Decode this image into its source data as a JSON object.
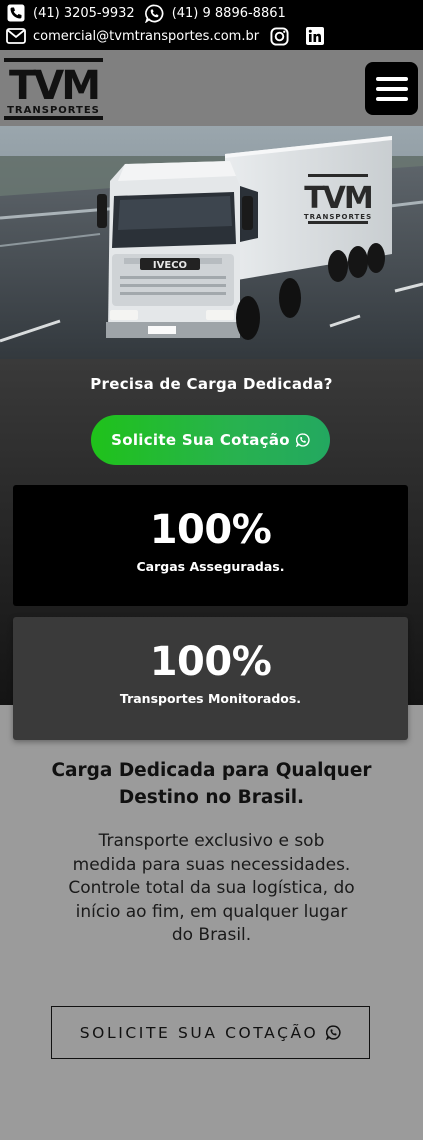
{
  "topbar": {
    "phone": "(41) 3205-9932",
    "whatsapp": "(41) 9 8896-8861",
    "email": "comercial@tvmtransportes.com.br",
    "icons": [
      "phone-icon",
      "whatsapp-icon",
      "mail-icon",
      "instagram-icon",
      "linkedin-icon"
    ]
  },
  "header": {
    "logo_main": "TVM",
    "logo_sub": "TRANSPORTES",
    "menu_icon": "hamburger-icon"
  },
  "hero": {
    "truck_logo_main": "TVM",
    "truck_logo_sub": "TRANSPORTES",
    "truck_brand": "IVECO"
  },
  "dedicated": {
    "question": "Precisa de Carga Dedicada?",
    "cta_label": "Solicite Sua Cotação"
  },
  "stats": [
    {
      "value": "100%",
      "label": "Cargas Asseguradas."
    },
    {
      "value": "100%",
      "label": "Transportes Monitorados."
    }
  ],
  "content": {
    "heading": "Carga Dedicada para Qualquer Destino no Brasil.",
    "description": "Transporte exclusivo e sob medida para suas necessidades. Controle total da sua logística, do início ao fim, em qualquer lugar do Brasil.",
    "cta_label": "SOLICITE SUA COTAÇÃO"
  },
  "colors": {
    "topbar_bg": "#000000",
    "header_bg": "#808080",
    "cta_green": "#22bb33",
    "page_bg": "#9b9b9b"
  }
}
